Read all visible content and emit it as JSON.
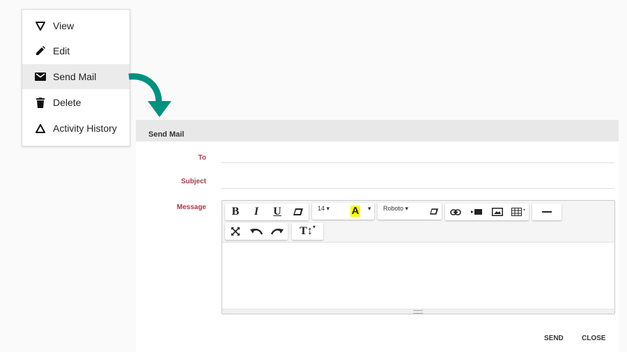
{
  "context_menu": {
    "items": [
      {
        "label": "View",
        "icon": "view-triangle-down-icon"
      },
      {
        "label": "Edit",
        "icon": "pencil-icon"
      },
      {
        "label": "Send Mail",
        "icon": "mail-icon",
        "active": true
      },
      {
        "label": "Delete",
        "icon": "trash-icon"
      },
      {
        "label": "Activity History",
        "icon": "triangle-up-icon"
      }
    ]
  },
  "arrow_color": "#009080",
  "dialog": {
    "title": "Send Mail",
    "fields": {
      "to_label": "To",
      "to_value": "",
      "subject_label": "Subject",
      "subject_value": "",
      "message_label": "Message",
      "message_value": ""
    },
    "toolbar": {
      "bold": "B",
      "italic": "I",
      "underline": "U",
      "font_size": "14",
      "highlight_glyph": "A",
      "highlight_color": "#ffff00",
      "font_name": "Roboto",
      "text_height_glyph": "T↕"
    },
    "actions": {
      "send": "SEND",
      "close": "CLOSE"
    }
  },
  "colors": {
    "label": "#a83a4a",
    "header_bg": "#e8e8e8"
  }
}
